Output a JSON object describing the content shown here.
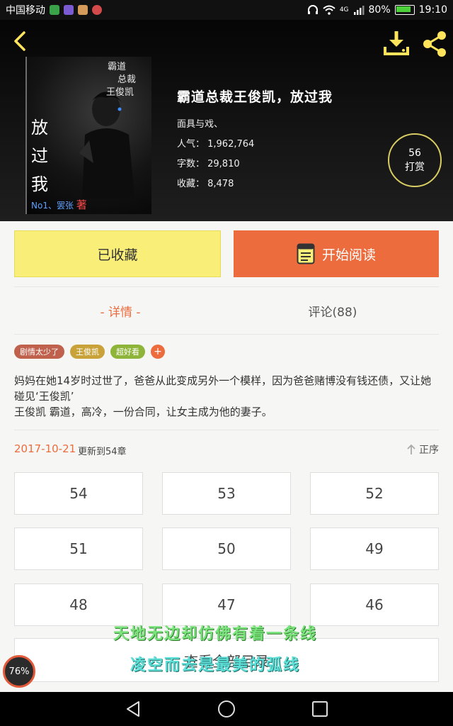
{
  "status_bar": {
    "carrier": "中国移动",
    "network": "4G",
    "battery": "80%",
    "battery_level": 0.8,
    "time": "19:10"
  },
  "header": {
    "icons": [
      "back-icon",
      "download-icon",
      "share-icon"
    ]
  },
  "book": {
    "cover": {
      "tagline_lines": [
        "霸道",
        "总裁",
        "王俊凯"
      ],
      "title_chars": [
        "放",
        "过",
        "我"
      ],
      "author_line": "No1、罢张",
      "author_mark": "著"
    },
    "title": "霸道总裁王俊凯，放过我",
    "author": "面具与戏、",
    "popularity": "人气： 1,962,764",
    "word_count": "字数： 29,810",
    "favorites": "收藏： 8,478",
    "reward": {
      "count": "56",
      "label": "打赏"
    }
  },
  "actions": {
    "favorited_label": "已收藏",
    "read_label": "开始阅读"
  },
  "tabs": {
    "detail": "- 详情 -",
    "comments": "评论(88)"
  },
  "tags": [
    {
      "label": "剧情太少了",
      "color": "#c0614e"
    },
    {
      "label": "王俊凯",
      "color": "#c9a33a"
    },
    {
      "label": "超好看",
      "color": "#8fb43a"
    },
    {
      "label": "+",
      "color": "#ec6c3e"
    }
  ],
  "description": {
    "paragraph1": "妈妈在她14岁时过世了，爸爸从此变成另外一个模样，因为爸爸赌博没有钱还债，又让她碰见‘王俊凯’",
    "paragraph2": "王俊凯 霸道，高冷，一份合同，让女主成为他的妻子。"
  },
  "update": {
    "date": "2017-10-21",
    "info": "更新到54章",
    "sort_label": "正序"
  },
  "chapters": [
    "54",
    "53",
    "52",
    "51",
    "50",
    "49",
    "48",
    "47",
    "46"
  ],
  "all_chapters_label": "查看全部目录",
  "overlay": {
    "line1": "天地无边却仿佛有着一条线",
    "line2": "凌空而去是最美的弧线"
  },
  "perf_badge": "76%",
  "colors": {
    "accent": "#ec6c3e",
    "favorite_yellow": "#f9ef78",
    "reward_ring": "#d8cc63"
  }
}
